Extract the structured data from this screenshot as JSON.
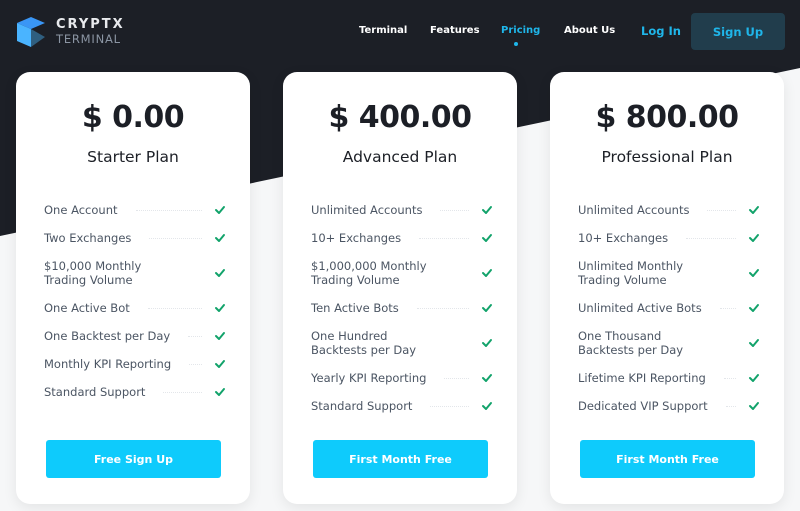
{
  "brand": {
    "title": "CRYPTX",
    "subtitle": "TERMINAL"
  },
  "nav": {
    "items": [
      {
        "label": "Terminal",
        "active": false
      },
      {
        "label": "Features",
        "active": false
      },
      {
        "label": "Pricing",
        "active": true
      },
      {
        "label": "About Us",
        "active": false
      }
    ],
    "login_label": "Log In",
    "signup_label": "Sign Up"
  },
  "colors": {
    "accent": "#1fb6ea",
    "cta": "#0ecbfc",
    "check": "#12a36b",
    "dark_bg": "#1c1f26"
  },
  "plans": [
    {
      "price": "$ 0.00",
      "name": "Starter Plan",
      "features": [
        "One Account",
        "Two Exchanges",
        "$10,000 Monthly Trading Volume",
        "One Active Bot",
        "One Backtest per Day",
        "Monthly KPI Reporting",
        "Standard Support"
      ],
      "cta": "Free Sign Up"
    },
    {
      "price": "$ 400.00",
      "name": "Advanced Plan",
      "features": [
        "Unlimited Accounts",
        "10+ Exchanges",
        "$1,000,000 Monthly Trading Volume",
        "Ten Active Bots",
        "One Hundred Backtests per Day",
        "Yearly KPI Reporting",
        "Standard Support"
      ],
      "cta": "First Month Free"
    },
    {
      "price": "$ 800.00",
      "name": "Professional Plan",
      "features": [
        "Unlimited Accounts",
        "10+ Exchanges",
        "Unlimited Monthly Trading Volume",
        "Unlimited Active Bots",
        "One Thousand Backtests per Day",
        "Lifetime KPI Reporting",
        "Dedicated VIP Support"
      ],
      "cta": "First Month Free"
    }
  ]
}
